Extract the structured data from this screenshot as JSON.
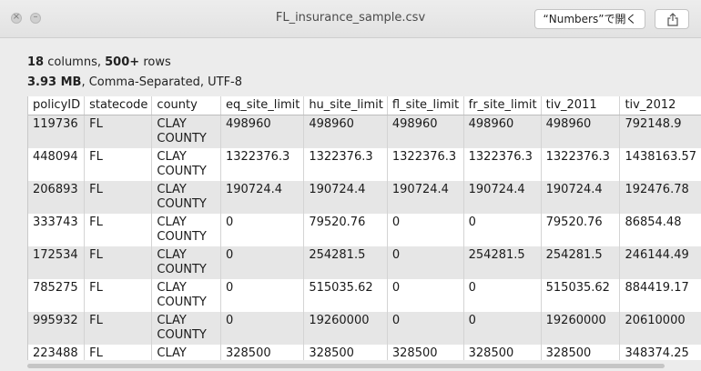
{
  "window": {
    "title": "FL_insurance_sample.csv",
    "open_with_label": "“Numbers”で開く",
    "close_glyph": "×",
    "mini_glyph": "–"
  },
  "info": {
    "columns_count": "18",
    "columns_word": "columns,",
    "rows_count": "500+",
    "rows_word": "rows",
    "size": "3.93 MB",
    "format": ", Comma-Separated, UTF-8"
  },
  "table": {
    "headers": [
      "policyID",
      "statecode",
      "county",
      "eq_site_limit",
      "hu_site_limit",
      "fl_site_limit",
      "fr_site_limit",
      "tiv_2011",
      "tiv_2012"
    ],
    "rows": [
      [
        "119736",
        "FL",
        "CLAY COUNTY",
        "498960",
        "498960",
        "498960",
        "498960",
        "498960",
        "792148.9"
      ],
      [
        "448094",
        "FL",
        "CLAY COUNTY",
        "1322376.3",
        "1322376.3",
        "1322376.3",
        "1322376.3",
        "1322376.3",
        "1438163.57"
      ],
      [
        "206893",
        "FL",
        "CLAY COUNTY",
        "190724.4",
        "190724.4",
        "190724.4",
        "190724.4",
        "190724.4",
        "192476.78"
      ],
      [
        "333743",
        "FL",
        "CLAY COUNTY",
        "0",
        "79520.76",
        "0",
        "0",
        "79520.76",
        "86854.48"
      ],
      [
        "172534",
        "FL",
        "CLAY COUNTY",
        "0",
        "254281.5",
        "0",
        "254281.5",
        "254281.5",
        "246144.49"
      ],
      [
        "785275",
        "FL",
        "CLAY COUNTY",
        "0",
        "515035.62",
        "0",
        "0",
        "515035.62",
        "884419.17"
      ],
      [
        "995932",
        "FL",
        "CLAY COUNTY",
        "0",
        "19260000",
        "0",
        "0",
        "19260000",
        "20610000"
      ],
      [
        "223488",
        "FL",
        "CLAY",
        "328500",
        "328500",
        "328500",
        "328500",
        "328500",
        "348374.25"
      ]
    ]
  }
}
